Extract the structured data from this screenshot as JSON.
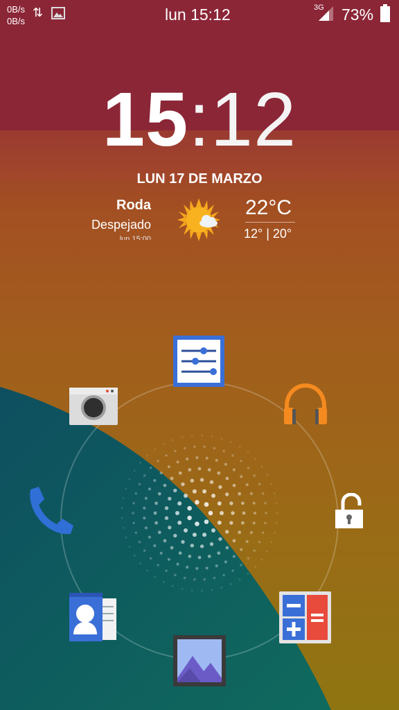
{
  "status_bar": {
    "net_up": "0B/s",
    "net_down": "0B/s",
    "data_icon": "up-down-arrows-icon",
    "notification_icon": "image-icon",
    "time": "lun 15:12",
    "network_type": "3G",
    "battery": "73%"
  },
  "lockscreen": {
    "clock_hours": "15",
    "clock_separator": ":",
    "clock_minutes": "12",
    "date": "LUN 17 DE MARZO"
  },
  "weather": {
    "city": "Roda",
    "condition": "Despejado",
    "updated": "lun 15:00",
    "icon": "sun-cloud-icon",
    "temperature": "22°C",
    "range": "12° | 20°"
  },
  "ring_targets": [
    "settings",
    "music",
    "unlock",
    "calculator",
    "gallery",
    "contacts",
    "phone",
    "camera"
  ],
  "colors": {
    "top_band": "#8b2637",
    "wave": "#0f5f63",
    "accent_blue": "#3a6fd8"
  }
}
